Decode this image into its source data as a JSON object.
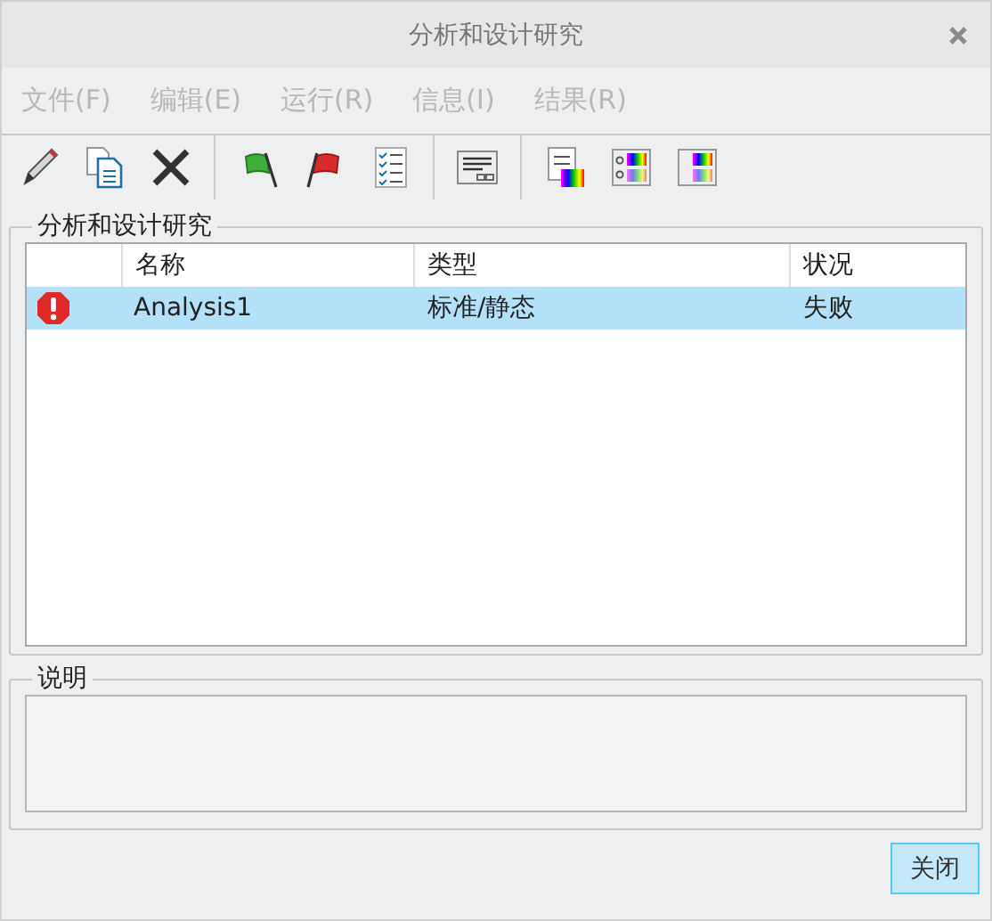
{
  "window": {
    "title": "分析和设计研究"
  },
  "menu": [
    {
      "label": "文件(F)",
      "disabled": true
    },
    {
      "label": "编辑(E)",
      "disabled": true
    },
    {
      "label": "运行(R)",
      "disabled": true
    },
    {
      "label": "信息(I)",
      "disabled": true
    },
    {
      "label": "结果(R)",
      "disabled": true
    }
  ],
  "studies": {
    "title": "分析和设计研究",
    "columns": [
      "名称",
      "类型",
      "状况"
    ],
    "rows": [
      {
        "kind": "error",
        "name": "Analysis1",
        "type": "标准/静态",
        "status": "失败",
        "selected": true
      }
    ]
  },
  "description": {
    "title": "说明"
  },
  "buttons": [
    {
      "label": "关闭",
      "selected": true
    }
  ]
}
